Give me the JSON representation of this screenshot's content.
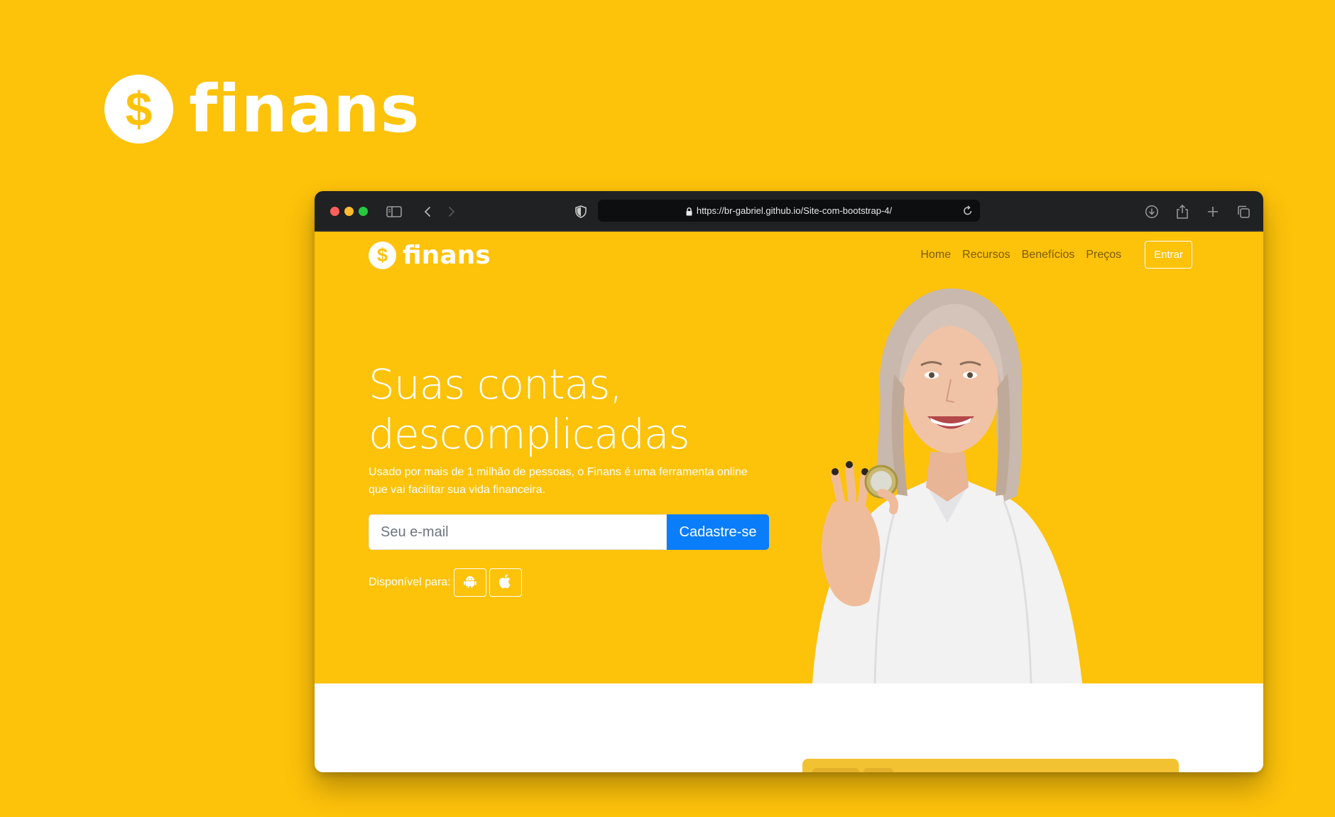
{
  "brand": {
    "symbol": "$",
    "name": "finans"
  },
  "browser": {
    "url": "https://br-gabriel.github.io/Site-com-bootstrap-4/",
    "icons": [
      "sidebar-icon",
      "back-icon",
      "forward-icon",
      "shield-icon",
      "lock-icon",
      "reload-icon",
      "download-icon",
      "share-icon",
      "new-tab-icon",
      "tabs-icon"
    ]
  },
  "site": {
    "logo": {
      "symbol": "$",
      "name": "finans"
    },
    "nav": {
      "home": "Home",
      "features": "Recursos",
      "benefits": "Benefícios",
      "pricing": "Preços",
      "login": "Entrar"
    },
    "hero": {
      "title_line1": "Suas contas,",
      "title_line2": "descomplicadas",
      "subtitle_line1": "Usado por mais de 1 milhão de pessoas, o Finans é uma ferramenta online",
      "subtitle_line2": "que vai facilitar sua vida financeira.",
      "email_placeholder": "Seu e-mail",
      "signup_button": "Cadastre-se",
      "available_label": "Disponível para:",
      "platforms": [
        "android-icon",
        "apple-icon"
      ]
    }
  },
  "colors": {
    "background": "#FDC20A",
    "accent_button": "#0a7dfb",
    "chrome": "#1f2123"
  }
}
